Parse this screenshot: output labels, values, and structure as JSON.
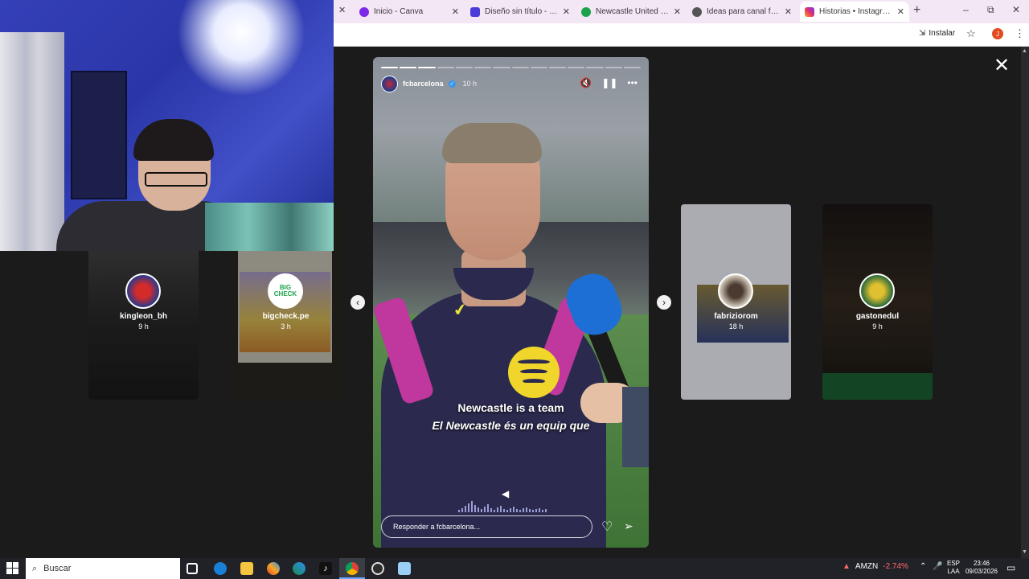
{
  "browser": {
    "tabs": [
      {
        "title": "Inicio - Canva",
        "favicon_color": "#7d2ae8"
      },
      {
        "title": "Diseño sin título - Video d",
        "favicon_color": "#4a3cd9"
      },
      {
        "title": "Newcastle United Vs FC B",
        "favicon_color": "#1aa34a"
      },
      {
        "title": "Ideas para canal fútbol",
        "favicon_color": "#555555"
      },
      {
        "title": "Historias • Instagram",
        "favicon_color": "#e1306c",
        "active": true
      }
    ],
    "install_label": "Instalar",
    "profile_initial": "J"
  },
  "stories": {
    "side_cards": [
      {
        "username": "kingleon_bh",
        "time": "9 h",
        "bg": "#3a3a3a"
      },
      {
        "username": "bigcheck.pe",
        "time": "3 h",
        "bg": "#b6b2a4",
        "avatar_text": "BIG CHECK"
      },
      {
        "username": "fabriziorom",
        "time": "18 h",
        "bg": "#c9cbd0"
      },
      {
        "username": "gastonedul",
        "time": "9 h",
        "bg": "#2a2420"
      }
    ],
    "main": {
      "username": "fcbarcelona",
      "time": "10 h",
      "subtitle_line1": "Newcastle is a team",
      "subtitle_line2": "El Newcastle és un equip que",
      "reply_placeholder": "Responder a fcbarcelona...",
      "progress_segments_total": 14,
      "progress_segments_done": 3
    }
  },
  "taskbar": {
    "search_placeholder": "Buscar",
    "stock_ticker": "AMZN",
    "stock_change": "-2.74%",
    "language_top": "ESP",
    "language_bottom": "LAA",
    "time": "23:46",
    "date": "09/03/2026"
  }
}
